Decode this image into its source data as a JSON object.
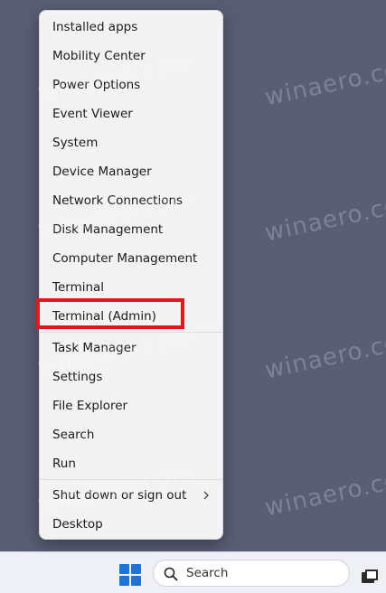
{
  "context_menu": {
    "items": [
      {
        "label": "Installed apps"
      },
      {
        "label": "Mobility Center"
      },
      {
        "label": "Power Options"
      },
      {
        "label": "Event Viewer"
      },
      {
        "label": "System"
      },
      {
        "label": "Device Manager"
      },
      {
        "label": "Network Connections"
      },
      {
        "label": "Disk Management"
      },
      {
        "label": "Computer Management"
      },
      {
        "label": "Terminal"
      },
      {
        "label": "Terminal (Admin)"
      },
      {
        "label": "Task Manager"
      },
      {
        "label": "Settings"
      },
      {
        "label": "File Explorer"
      },
      {
        "label": "Search"
      },
      {
        "label": "Run"
      },
      {
        "label": "Shut down or sign out",
        "submenu_icon": "chevron-right-icon"
      },
      {
        "label": "Desktop"
      }
    ]
  },
  "highlight": {
    "target": "Terminal (Admin)",
    "color": "#e8141c"
  },
  "taskbar": {
    "start_icon": "windows-logo-icon",
    "search_placeholder": "Search",
    "search_icon": "search-icon",
    "task_view_icon": "task-view-icon"
  },
  "watermark": {
    "text": "winaero.com",
    "text_short": "winaero.co"
  },
  "colors": {
    "desktop_bg": "#5a5e75",
    "menu_bg": "#f3f3f3",
    "accent": "#1e74d6"
  }
}
